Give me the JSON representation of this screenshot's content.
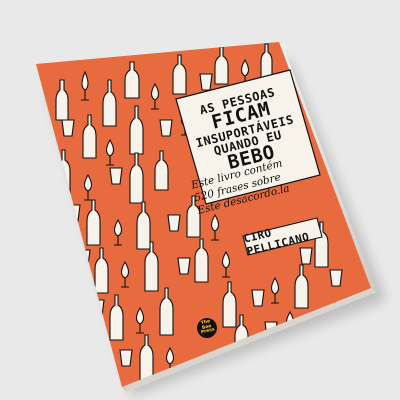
{
  "book": {
    "title_lines": [
      "AS PESSOAS",
      "FICAM",
      "INSUPORTÁVEIS",
      "QUANDO EU",
      "BEBO"
    ],
    "subtitle_lines": [
      "Este livro contém",
      "520 frases sobre",
      "Este desacordo.la"
    ],
    "author": "CIRO PELLICANO",
    "publisher_lines": [
      "The",
      "Bee",
      "Press"
    ]
  },
  "colors": {
    "background": "#e9e9e9",
    "cover": "#e86b3f",
    "panel": "#f7f3ea",
    "ink": "#111111",
    "logo_text": "#ffc23a"
  }
}
